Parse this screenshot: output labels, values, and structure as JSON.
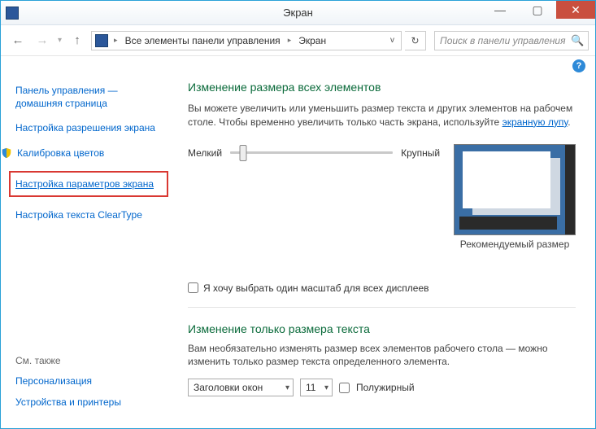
{
  "window": {
    "title": "Экран",
    "min_tooltip": "Свернуть",
    "max_tooltip": "Развернуть",
    "close_tooltip": "Закрыть"
  },
  "nav": {
    "back_tooltip": "Назад",
    "forward_tooltip": "Вперёд",
    "up_tooltip": "Вверх",
    "breadcrumb_root": "Все элементы панели управления",
    "breadcrumb_leaf": "Экран",
    "refresh_tooltip": "Обновить",
    "search_placeholder": "Поиск в панели управления"
  },
  "help": {
    "tooltip": "Справка"
  },
  "sidebar": {
    "home": "Панель управления — домашняя страница",
    "resolution": "Настройка разрешения экрана",
    "calibration": "Калибровка цветов",
    "display_params": "Настройка параметров экрана",
    "cleartype": "Настройка текста ClearType",
    "see_also_header": "См. также",
    "personalization": "Персонализация",
    "devices_printers": "Устройства и принтеры"
  },
  "content": {
    "heading": "Изменение размера всех элементов",
    "description_prefix": "Вы можете увеличить или уменьшить размер текста и других элементов на рабочем столе. Чтобы временно увеличить только часть экрана, используйте ",
    "description_link": "экранную лупу",
    "slider_min": "Мелкий",
    "slider_max": "Крупный",
    "sample_caption": "Рекомендуемый размер",
    "checkbox_label": "Я хочу выбрать один масштаб для всех дисплеев",
    "subheading": "Изменение только размера текста",
    "subdesc": "Вам необязательно изменять размер всех элементов рабочего стола — можно изменить только размер текста определенного элемента.",
    "element_select": "Заголовки окон",
    "size_select": "11",
    "bold_label": "Полужирный"
  }
}
